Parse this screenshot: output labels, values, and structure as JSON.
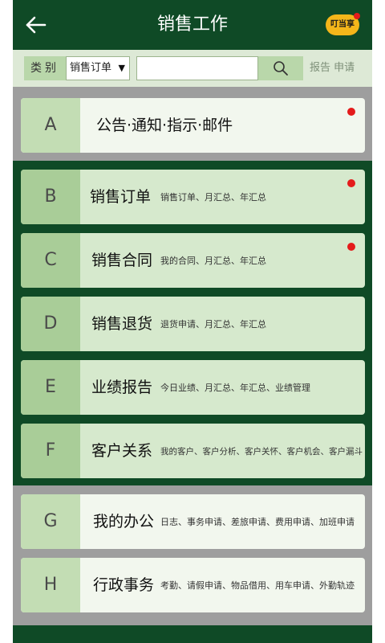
{
  "header": {
    "title": "销售工作",
    "brand_label": "叮当享"
  },
  "filter": {
    "category_label": "类别",
    "category_value": "销售订单",
    "search_value": "",
    "report_link": "报告 申请"
  },
  "cards": [
    {
      "letter": "A",
      "title": "公告·通知·指示·邮件",
      "sub": "",
      "dot": true
    },
    {
      "letter": "B",
      "title": "销售订单",
      "sub": "销售订单、月汇总、年汇总",
      "dot": true
    },
    {
      "letter": "C",
      "title": "销售合同",
      "sub": "我的合同、月汇总、年汇总",
      "dot": true
    },
    {
      "letter": "D",
      "title": "销售退货",
      "sub": "退货申请、月汇总、年汇总",
      "dot": false
    },
    {
      "letter": "E",
      "title": "业绩报告",
      "sub": "今日业绩、月汇总、年汇总、业绩管理",
      "dot": false
    },
    {
      "letter": "F",
      "title": "客户关系",
      "sub": "我的客户、客户分析、客户关怀、客户机会、客户漏斗",
      "dot": false
    },
    {
      "letter": "G",
      "title": "我的办公",
      "sub": "日志、事务申请、差旅申请、费用申请、加班申请",
      "dot": false
    },
    {
      "letter": "H",
      "title": "行政事务",
      "sub": "考勤、请假申请、物品借用、用车申请、外勤轨迹",
      "dot": false
    }
  ],
  "colors": {
    "header_bg": "#0f4a26",
    "accent_light": "#c3ddb4",
    "badge": "#e41b1b",
    "brand": "#f4b61a"
  }
}
